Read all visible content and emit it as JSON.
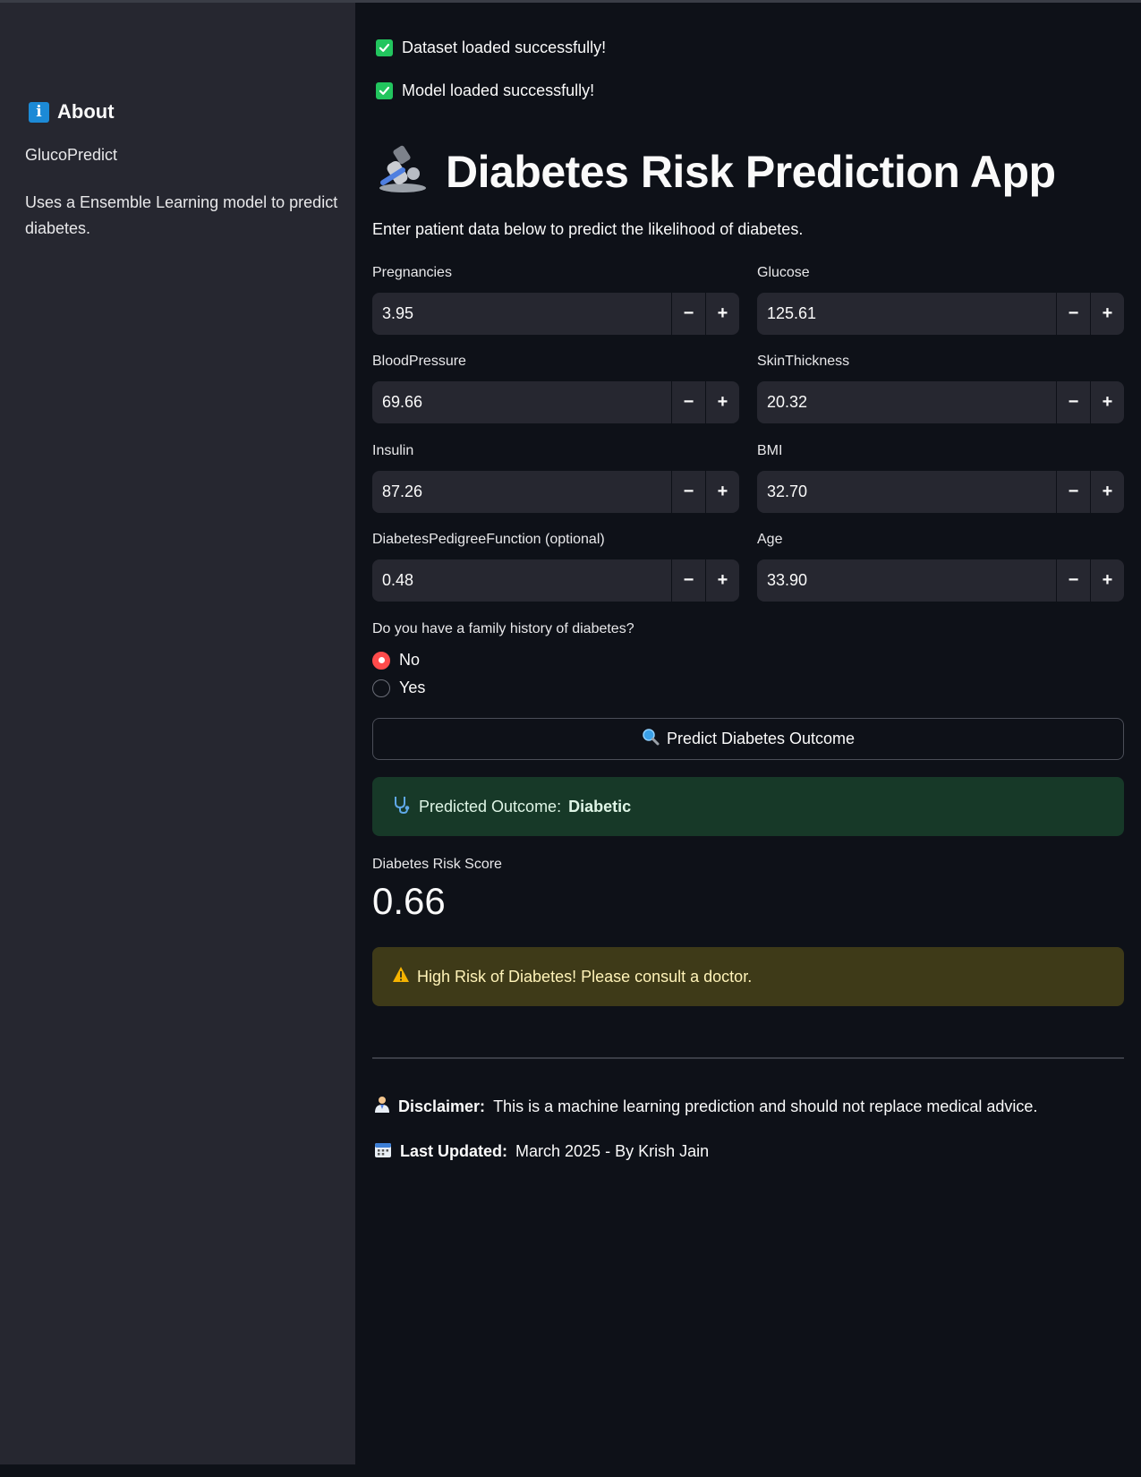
{
  "sidebar": {
    "about_title": "About",
    "app_name": "GlucoPredict",
    "description": "Uses a Ensemble Learning model to predict diabetes."
  },
  "status": {
    "dataset": "Dataset loaded successfully!",
    "model": "Model loaded successfully!"
  },
  "header": {
    "title": "Diabetes Risk Prediction App",
    "subtitle": "Enter patient data below to predict the likelihood of diabetes."
  },
  "fields": [
    {
      "label": "Pregnancies",
      "value": "3.95"
    },
    {
      "label": "Glucose",
      "value": "125.61"
    },
    {
      "label": "BloodPressure",
      "value": "69.66"
    },
    {
      "label": "SkinThickness",
      "value": "20.32"
    },
    {
      "label": "Insulin",
      "value": "87.26"
    },
    {
      "label": "BMI",
      "value": "32.70"
    },
    {
      "label": "DiabetesPedigreeFunction (optional)",
      "value": "0.48"
    },
    {
      "label": "Age",
      "value": "33.90"
    }
  ],
  "stepper": {
    "minus": "−",
    "plus": "+"
  },
  "family_history": {
    "question": "Do you have a family history of diabetes?",
    "options": [
      "No",
      "Yes"
    ],
    "selected": "No"
  },
  "predict_button": "Predict Diabetes Outcome",
  "result": {
    "outcome_prefix": "Predicted Outcome:",
    "outcome_value": "Diabetic",
    "risk_label": "Diabetes Risk Score",
    "risk_value": "0.66",
    "warning": "High Risk of Diabetes! Please consult a doctor."
  },
  "footer": {
    "disclaimer_label": "Disclaimer:",
    "disclaimer_text": "This is a machine learning prediction and should not replace medical advice.",
    "updated_label": "Last Updated:",
    "updated_text": "March 2025 - By Krish Jain"
  },
  "colors": {
    "background": "#0e1118",
    "sidebar": "#262730",
    "accent_radio": "#ff4b4b",
    "success_check": "#22c55e",
    "success_box": "#173928",
    "warning_box": "#3e3a18"
  }
}
